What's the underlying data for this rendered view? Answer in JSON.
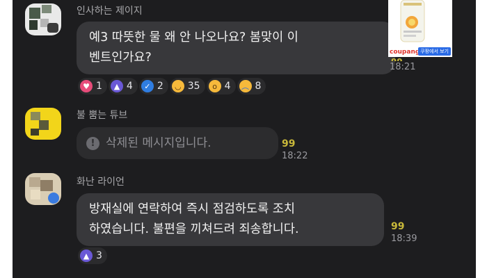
{
  "messages": [
    {
      "sender": "인사하는 제이지",
      "text_line1": "예3 따뜻한 물 왜 안 나오나요? 봄맞이 이",
      "text_line2": "벤트인가요?",
      "time": "18:21",
      "unread": "99",
      "reactions": [
        {
          "icon": "heart-icon",
          "count": "1",
          "color": "#e84c7a"
        },
        {
          "icon": "thumbs-up-icon",
          "count": "4",
          "color": "#6a58d6"
        },
        {
          "icon": "check-icon",
          "count": "2",
          "color": "#2f7de1"
        },
        {
          "icon": "laughing-emoji-icon",
          "count": "35",
          "color": "#f6b93b"
        },
        {
          "icon": "surprised-emoji-icon",
          "count": "4",
          "color": "#f6b93b"
        },
        {
          "icon": "crying-emoji-icon",
          "count": "8",
          "color": "#f6b93b"
        }
      ]
    },
    {
      "sender": "불 뿜는 튜브",
      "text": "삭제된 메시지입니다.",
      "time": "18:22",
      "unread": "99"
    },
    {
      "sender": "화난 라이언",
      "text_line1": "방재실에 연락하여 즉시 점검하도록 조치",
      "text_line2": "하였습니다. 불편을 끼쳐드려 죄송합니다.",
      "time": "18:39",
      "unread": "99",
      "reactions": [
        {
          "icon": "thumbs-up-icon",
          "count": "3",
          "color": "#6a58d6"
        }
      ]
    }
  ],
  "ad": {
    "brand": "coupang",
    "button": "쿠팡에서 보기"
  },
  "colors": {
    "background": "#1d1d1f",
    "bubble": "#38383b",
    "unread": "#c9b93a"
  }
}
